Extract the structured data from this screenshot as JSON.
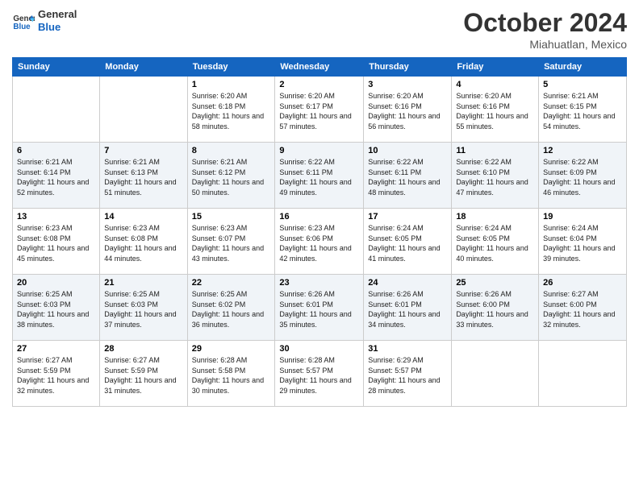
{
  "logo": {
    "line1": "General",
    "line2": "Blue"
  },
  "title": "October 2024",
  "location": "Miahuatlan, Mexico",
  "days_of_week": [
    "Sunday",
    "Monday",
    "Tuesday",
    "Wednesday",
    "Thursday",
    "Friday",
    "Saturday"
  ],
  "weeks": [
    [
      {
        "day": "",
        "sunrise": "",
        "sunset": "",
        "daylight": ""
      },
      {
        "day": "",
        "sunrise": "",
        "sunset": "",
        "daylight": ""
      },
      {
        "day": "1",
        "sunrise": "Sunrise: 6:20 AM",
        "sunset": "Sunset: 6:18 PM",
        "daylight": "Daylight: 11 hours and 58 minutes."
      },
      {
        "day": "2",
        "sunrise": "Sunrise: 6:20 AM",
        "sunset": "Sunset: 6:17 PM",
        "daylight": "Daylight: 11 hours and 57 minutes."
      },
      {
        "day": "3",
        "sunrise": "Sunrise: 6:20 AM",
        "sunset": "Sunset: 6:16 PM",
        "daylight": "Daylight: 11 hours and 56 minutes."
      },
      {
        "day": "4",
        "sunrise": "Sunrise: 6:20 AM",
        "sunset": "Sunset: 6:16 PM",
        "daylight": "Daylight: 11 hours and 55 minutes."
      },
      {
        "day": "5",
        "sunrise": "Sunrise: 6:21 AM",
        "sunset": "Sunset: 6:15 PM",
        "daylight": "Daylight: 11 hours and 54 minutes."
      }
    ],
    [
      {
        "day": "6",
        "sunrise": "Sunrise: 6:21 AM",
        "sunset": "Sunset: 6:14 PM",
        "daylight": "Daylight: 11 hours and 52 minutes."
      },
      {
        "day": "7",
        "sunrise": "Sunrise: 6:21 AM",
        "sunset": "Sunset: 6:13 PM",
        "daylight": "Daylight: 11 hours and 51 minutes."
      },
      {
        "day": "8",
        "sunrise": "Sunrise: 6:21 AM",
        "sunset": "Sunset: 6:12 PM",
        "daylight": "Daylight: 11 hours and 50 minutes."
      },
      {
        "day": "9",
        "sunrise": "Sunrise: 6:22 AM",
        "sunset": "Sunset: 6:11 PM",
        "daylight": "Daylight: 11 hours and 49 minutes."
      },
      {
        "day": "10",
        "sunrise": "Sunrise: 6:22 AM",
        "sunset": "Sunset: 6:11 PM",
        "daylight": "Daylight: 11 hours and 48 minutes."
      },
      {
        "day": "11",
        "sunrise": "Sunrise: 6:22 AM",
        "sunset": "Sunset: 6:10 PM",
        "daylight": "Daylight: 11 hours and 47 minutes."
      },
      {
        "day": "12",
        "sunrise": "Sunrise: 6:22 AM",
        "sunset": "Sunset: 6:09 PM",
        "daylight": "Daylight: 11 hours and 46 minutes."
      }
    ],
    [
      {
        "day": "13",
        "sunrise": "Sunrise: 6:23 AM",
        "sunset": "Sunset: 6:08 PM",
        "daylight": "Daylight: 11 hours and 45 minutes."
      },
      {
        "day": "14",
        "sunrise": "Sunrise: 6:23 AM",
        "sunset": "Sunset: 6:08 PM",
        "daylight": "Daylight: 11 hours and 44 minutes."
      },
      {
        "day": "15",
        "sunrise": "Sunrise: 6:23 AM",
        "sunset": "Sunset: 6:07 PM",
        "daylight": "Daylight: 11 hours and 43 minutes."
      },
      {
        "day": "16",
        "sunrise": "Sunrise: 6:23 AM",
        "sunset": "Sunset: 6:06 PM",
        "daylight": "Daylight: 11 hours and 42 minutes."
      },
      {
        "day": "17",
        "sunrise": "Sunrise: 6:24 AM",
        "sunset": "Sunset: 6:05 PM",
        "daylight": "Daylight: 11 hours and 41 minutes."
      },
      {
        "day": "18",
        "sunrise": "Sunrise: 6:24 AM",
        "sunset": "Sunset: 6:05 PM",
        "daylight": "Daylight: 11 hours and 40 minutes."
      },
      {
        "day": "19",
        "sunrise": "Sunrise: 6:24 AM",
        "sunset": "Sunset: 6:04 PM",
        "daylight": "Daylight: 11 hours and 39 minutes."
      }
    ],
    [
      {
        "day": "20",
        "sunrise": "Sunrise: 6:25 AM",
        "sunset": "Sunset: 6:03 PM",
        "daylight": "Daylight: 11 hours and 38 minutes."
      },
      {
        "day": "21",
        "sunrise": "Sunrise: 6:25 AM",
        "sunset": "Sunset: 6:03 PM",
        "daylight": "Daylight: 11 hours and 37 minutes."
      },
      {
        "day": "22",
        "sunrise": "Sunrise: 6:25 AM",
        "sunset": "Sunset: 6:02 PM",
        "daylight": "Daylight: 11 hours and 36 minutes."
      },
      {
        "day": "23",
        "sunrise": "Sunrise: 6:26 AM",
        "sunset": "Sunset: 6:01 PM",
        "daylight": "Daylight: 11 hours and 35 minutes."
      },
      {
        "day": "24",
        "sunrise": "Sunrise: 6:26 AM",
        "sunset": "Sunset: 6:01 PM",
        "daylight": "Daylight: 11 hours and 34 minutes."
      },
      {
        "day": "25",
        "sunrise": "Sunrise: 6:26 AM",
        "sunset": "Sunset: 6:00 PM",
        "daylight": "Daylight: 11 hours and 33 minutes."
      },
      {
        "day": "26",
        "sunrise": "Sunrise: 6:27 AM",
        "sunset": "Sunset: 6:00 PM",
        "daylight": "Daylight: 11 hours and 32 minutes."
      }
    ],
    [
      {
        "day": "27",
        "sunrise": "Sunrise: 6:27 AM",
        "sunset": "Sunset: 5:59 PM",
        "daylight": "Daylight: 11 hours and 32 minutes."
      },
      {
        "day": "28",
        "sunrise": "Sunrise: 6:27 AM",
        "sunset": "Sunset: 5:59 PM",
        "daylight": "Daylight: 11 hours and 31 minutes."
      },
      {
        "day": "29",
        "sunrise": "Sunrise: 6:28 AM",
        "sunset": "Sunset: 5:58 PM",
        "daylight": "Daylight: 11 hours and 30 minutes."
      },
      {
        "day": "30",
        "sunrise": "Sunrise: 6:28 AM",
        "sunset": "Sunset: 5:57 PM",
        "daylight": "Daylight: 11 hours and 29 minutes."
      },
      {
        "day": "31",
        "sunrise": "Sunrise: 6:29 AM",
        "sunset": "Sunset: 5:57 PM",
        "daylight": "Daylight: 11 hours and 28 minutes."
      },
      {
        "day": "",
        "sunrise": "",
        "sunset": "",
        "daylight": ""
      },
      {
        "day": "",
        "sunrise": "",
        "sunset": "",
        "daylight": ""
      }
    ]
  ]
}
